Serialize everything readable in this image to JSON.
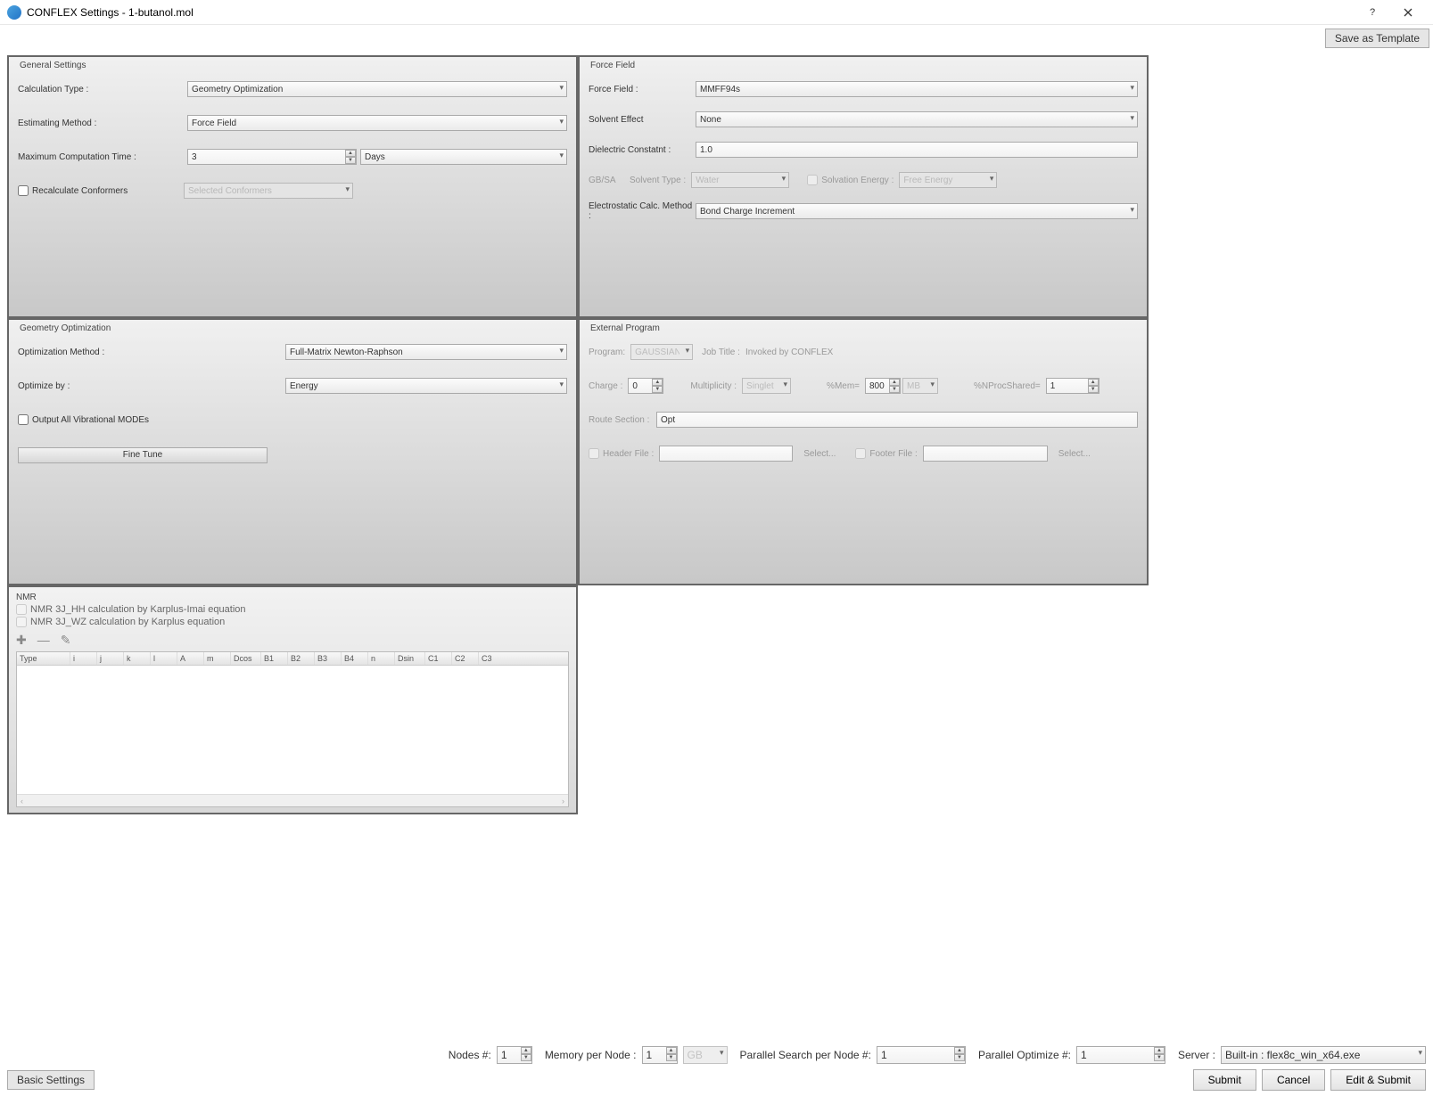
{
  "title": "CONFLEX Settings - 1-butanol.mol",
  "save_template_btn": "Save as Template",
  "general": {
    "legend": "General Settings",
    "calc_type_label": "Calculation Type :",
    "calc_type_value": "Geometry Optimization",
    "est_method_label": "Estimating Method :",
    "est_method_value": "Force Field",
    "max_comp_label": "Maximum Computation Time :",
    "max_comp_value": "3",
    "max_comp_unit": "Days",
    "recalc_label": "Recalculate Conformers",
    "recalc_select": "Selected Conformers"
  },
  "forcefield": {
    "legend": "Force Field",
    "ff_label": "Force Field :",
    "ff_value": "MMFF94s",
    "solvent_label": "Solvent Effect",
    "solvent_value": "None",
    "dielectric_label": "Dielectric Constatnt :",
    "dielectric_value": "1.0",
    "gbsa_label": "GB/SA",
    "solvent_type_label": "Solvent Type :",
    "solvent_type_value": "Water",
    "solvation_energy_label": "Solvation Energy :",
    "solvation_energy_value": "Free Energy",
    "electro_label": "Electrostatic Calc. Method :",
    "electro_value": "Bond Charge Increment"
  },
  "geoopt": {
    "legend": "Geometry Optimization",
    "opt_method_label": "Optimization Method :",
    "opt_method_value": "Full-Matrix Newton-Raphson",
    "optimize_by_label": "Optimize by :",
    "optimize_by_value": "Energy",
    "output_vib_label": "Output All Vibrational MODEs",
    "fine_tune_btn": "Fine Tune"
  },
  "external": {
    "legend": "External Program",
    "program_label": "Program:",
    "program_value": "GAUSSIAN",
    "jobtitle_label": "Job Title :",
    "jobtitle_value": "Invoked by CONFLEX",
    "charge_label": "Charge :",
    "charge_value": "0",
    "multiplicity_label": "Multiplicity :",
    "multiplicity_value": "Singlet",
    "mem_label": "%Mem=",
    "mem_value": "800",
    "mem_unit": "MB",
    "nproc_label": "%NProcShared=",
    "nproc_value": "1",
    "route_label": "Route Section :",
    "route_value": "Opt",
    "header_file_label": "Header File :",
    "footer_file_label": "Footer File :",
    "select_btn": "Select..."
  },
  "nmr": {
    "legend": "NMR",
    "hh_label": "NMR 3J_HH calculation by Karplus-Imai equation",
    "wz_label": "NMR 3J_WZ calculation by Karplus equation",
    "cols": [
      "Type",
      "i",
      "j",
      "k",
      "l",
      "A",
      "m",
      "Dcos",
      "B1",
      "B2",
      "B3",
      "B4",
      "n",
      "Dsin",
      "C1",
      "C2",
      "C3"
    ]
  },
  "bottom": {
    "nodes_label": "Nodes #:",
    "nodes_value": "1",
    "mem_per_node_label": "Memory per Node :",
    "mem_per_node_value": "1",
    "mem_unit": "GB",
    "parallel_search_label": "Parallel Search per Node #:",
    "parallel_search_value": "1",
    "parallel_opt_label": "Parallel Optimize #:",
    "parallel_opt_value": "1",
    "server_label": "Server :",
    "server_value": "Built-in : flex8c_win_x64.exe",
    "submit": "Submit",
    "cancel": "Cancel",
    "edit_submit": "Edit & Submit"
  },
  "basic_settings_btn": "Basic Settings"
}
